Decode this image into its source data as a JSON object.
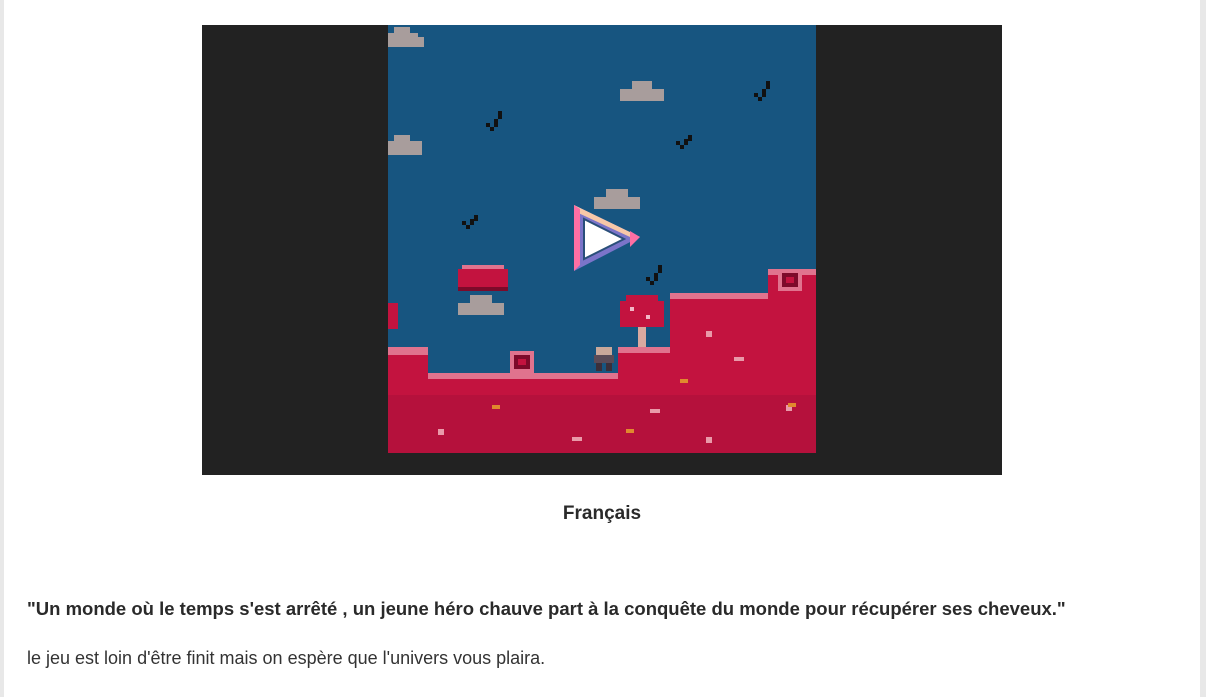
{
  "game": {
    "language_caption": "Français",
    "tagline": "\"Un monde où le temps s'est arrêté ,  un jeune héro chauve part à la conquête du monde pour récupérer ses cheveux.\"",
    "description": "le jeu est loin d'être finit mais on espère que l'univers vous plaira."
  },
  "colors": {
    "player_bg": "#222222",
    "sky": "#175580",
    "ground": "#c3133f",
    "ground_dark": "#7d0a2a",
    "cloud": "#a89d9c",
    "play_accent_pink": "#ff6fa3",
    "play_accent_peach": "#f7c8a8",
    "play_accent_purple": "#7b74c9"
  },
  "icons": {
    "play": "play-icon",
    "bird": "bird-icon",
    "cloud": "cloud-icon",
    "hero": "hero-sprite",
    "mushroom": "mushroom-tree",
    "crate": "crate-block"
  }
}
